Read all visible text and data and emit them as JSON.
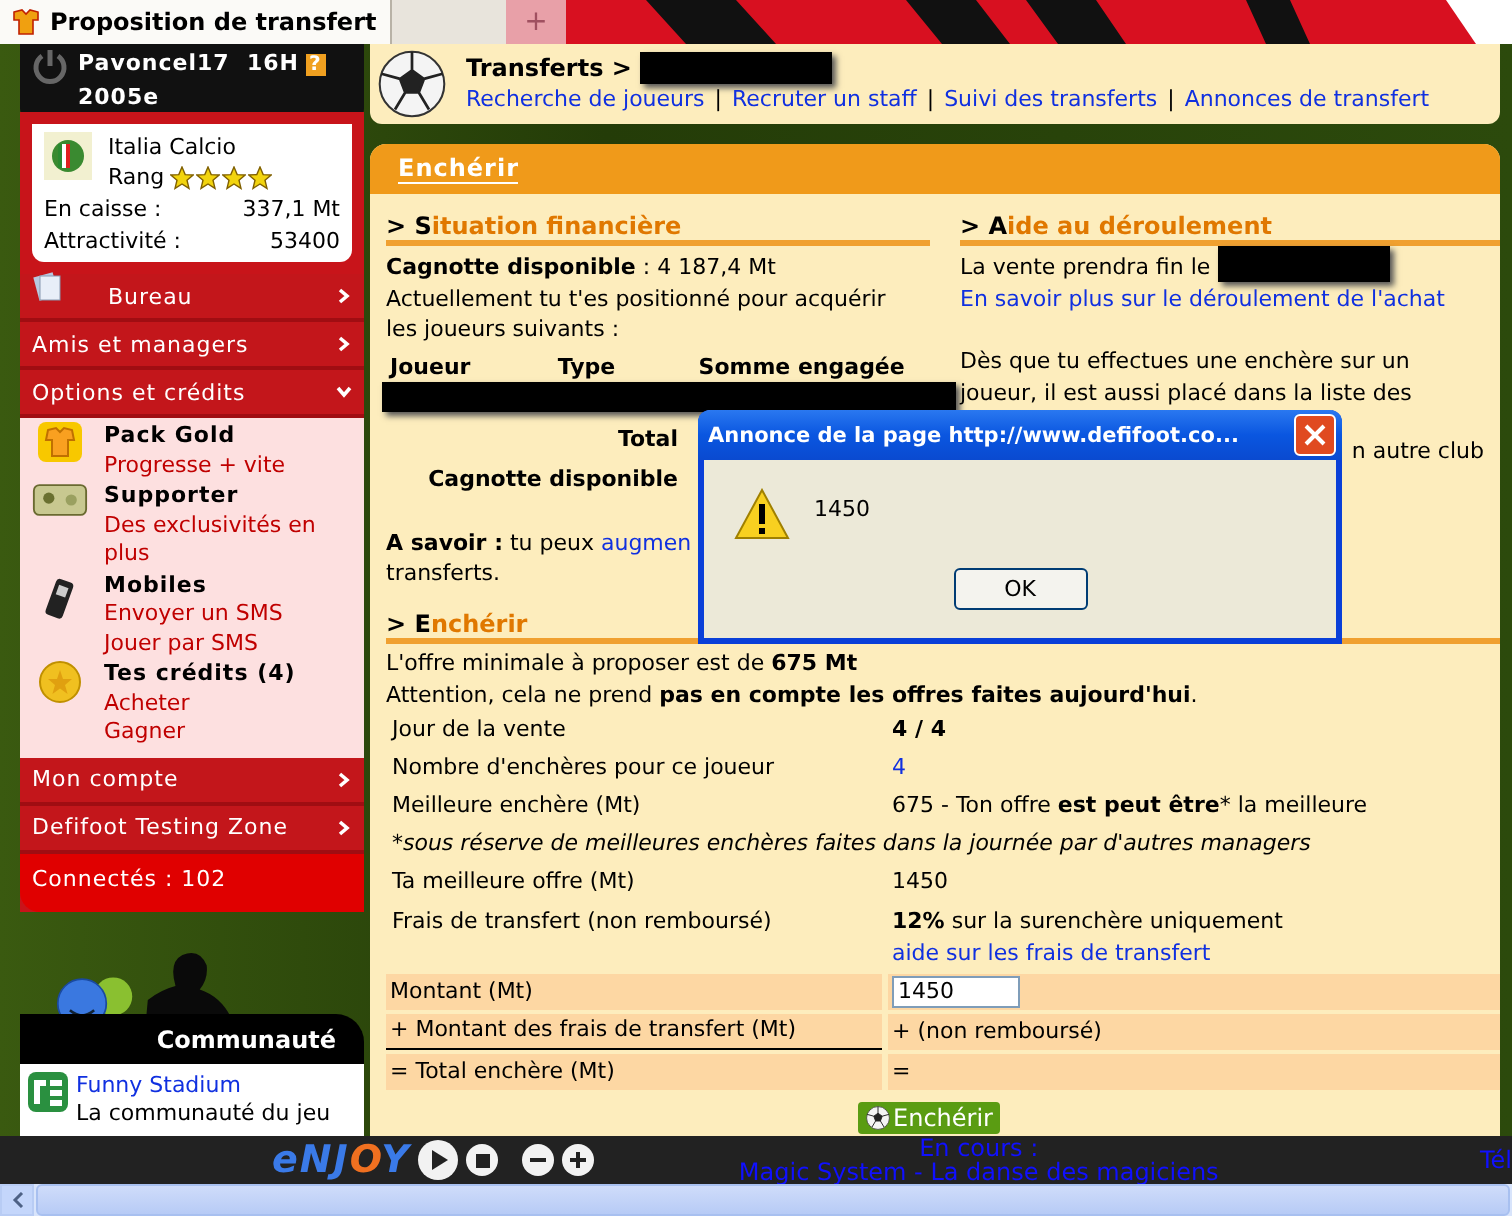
{
  "browser": {
    "tabs": [
      {
        "label": "Proposition de transfert",
        "selected": true
      }
    ],
    "new_tab": "+"
  },
  "sidebar": {
    "user": {
      "name": "Pavoncel17",
      "time": "16H",
      "help": "?",
      "season": "2005e"
    },
    "club": {
      "name": "Italia Calcio",
      "rank_label": "Rang",
      "stars": 4,
      "stats": [
        {
          "label": "En caisse :",
          "value": "337,1 Mt"
        },
        {
          "label": "Attractivité :",
          "value": "53400"
        }
      ]
    },
    "menu": [
      {
        "label": "Bureau",
        "kind": "office",
        "expanded": false
      },
      {
        "label": "Amis et managers",
        "kind": "plain",
        "expanded": false
      },
      {
        "label": "Options et crédits",
        "kind": "plain",
        "expanded": true,
        "children": [
          {
            "title": "Pack Gold",
            "kind": "gold",
            "links": [
              "Progresse + vite"
            ]
          },
          {
            "title": "Supporter",
            "kind": "supporter",
            "links": [
              "Des exclusivités en plus"
            ]
          },
          {
            "title": "Mobiles",
            "kind": "mobile",
            "links": [
              "Envoyer un SMS",
              "Jouer par SMS"
            ]
          },
          {
            "title": "Tes crédits (4)",
            "kind": "credits",
            "links": [
              "Acheter",
              "Gagner"
            ]
          }
        ]
      },
      {
        "label": "Mon compte",
        "kind": "plain",
        "expanded": false
      },
      {
        "label": "Defifoot Testing Zone",
        "kind": "plain",
        "expanded": false
      }
    ],
    "online": "Connectés : 102",
    "community": {
      "title": "Communauté",
      "link": "Funny Stadium",
      "text": "La communauté du jeu"
    }
  },
  "header": {
    "breadcrumb": "Transferts >",
    "separator": "|",
    "links": [
      "Recherche de joueurs",
      "Recruter un staff",
      "Suivi des transferts",
      "Annonces de transfert"
    ]
  },
  "panel": {
    "tab": "Enchérir",
    "finance": {
      "lead": "> S",
      "rest": "ituation financière",
      "balance": "**Cagnotte disponible** : 4 187,4 Mt",
      "text": "Actuellement tu t'es positionné pour acquérir les joueurs suivants :",
      "columns": [
        "Joueur",
        "Type",
        "Somme engagée"
      ],
      "totals": [
        "Total",
        "Cagnotte disponible"
      ],
      "note_start": "**A savoir :** tu peux ",
      "note_link": "augmen",
      "note_end": "transferts."
    },
    "help": {
      "lead": "> A",
      "rest": "ide au déroulement",
      "end_text": "La vente prendra fin le",
      "link": "En savoir plus sur le déroulement de l'achat",
      "text": "Dès que tu effectues une enchère sur un joueur, il est aussi placé dans la liste des",
      "fragment": "n autre club"
    },
    "bid": {
      "lead": "> E",
      "rest": "nchérir",
      "intro": [
        "L'offre minimale à proposer est de **675 Mt**",
        "Attention, cela ne prend **pas en compte les offres faites aujourd'hui**."
      ],
      "rows": [
        {
          "kind": "bold",
          "label": "Jour de la vente",
          "value": "4 / 4"
        },
        {
          "kind": "link",
          "label": "Nombre d'enchères pour ce joueur",
          "value": "4"
        },
        {
          "kind": "text",
          "label": "Meilleure enchère (Mt)",
          "value": "675 - Ton offre **est peut être**",
          "suffix": "* la meilleure"
        },
        {
          "kind": "note",
          "label": "*sous réserve de meilleures enchères faites dans la journée par d'autres managers"
        },
        {
          "kind": "text",
          "label": "Ta meilleure offre (Mt)",
          "value": "1450"
        },
        {
          "kind": "text",
          "label": "Frais de transfert (non remboursé)",
          "value": "**12%** sur la surenchère uniquement",
          "link": "aide sur les frais de transfert"
        }
      ],
      "calc": [
        {
          "kind": "input",
          "label": "Montant (Mt)",
          "value": "1450"
        },
        {
          "kind": "text",
          "label": "+ Montant des frais de transfert (Mt)",
          "value": "+ (non remboursé)"
        },
        {
          "kind": "text",
          "label": "= Total enchère (Mt)",
          "value": "="
        }
      ],
      "button": "Enchérir"
    }
  },
  "dialog": {
    "title": "Annonce de la page http://www.defifoot.co...",
    "message": "1450",
    "button": "OK"
  },
  "player": {
    "logo": "eNJOY",
    "now_label": "En cours :",
    "track": "Magic System - La danse des magiciens",
    "edge": "Tél"
  }
}
